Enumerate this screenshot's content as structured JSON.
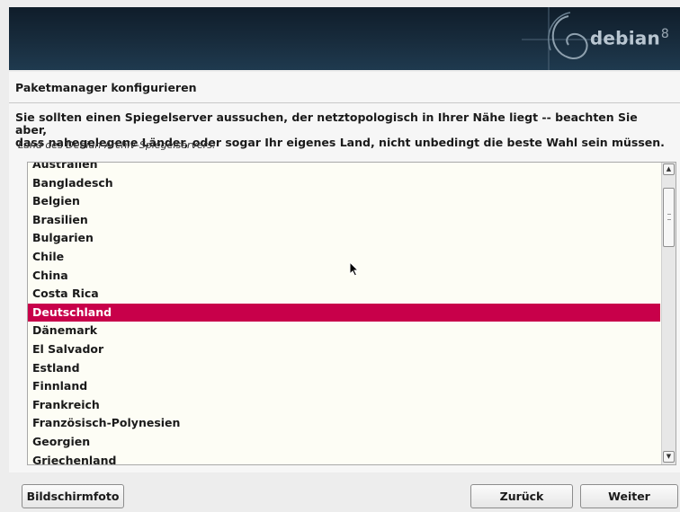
{
  "banner": {
    "brand": "debian",
    "version": "8"
  },
  "section": {
    "title": "Paketmanager konfigurieren"
  },
  "description": {
    "line1": "Sie sollten einen Spiegelserver aussuchen, der netztopologisch in Ihrer Nähe liegt -- beachten Sie aber,",
    "line2": "dass nahegelegene Länder, oder sogar Ihr eigenes Land, nicht unbedingt die beste Wahl sein müssen."
  },
  "field_label": "Land des Debian-Archiv-Spiegelservers:",
  "countries": [
    "Australien",
    "Bangladesch",
    "Belgien",
    "Brasilien",
    "Bulgarien",
    "Chile",
    "China",
    "Costa Rica",
    "Deutschland",
    "Dänemark",
    "El Salvador",
    "Estland",
    "Finnland",
    "Frankreich",
    "Französisch-Polynesien",
    "Georgien",
    "Griechenland"
  ],
  "selected_country": "Deutschland",
  "buttons": {
    "screenshot": "Bildschirmfoto",
    "back": "Zurück",
    "next": "Weiter"
  },
  "colors": {
    "selection": "#c8004a",
    "banner": "#182c3d"
  },
  "icons": {
    "scroll_up": "chevron-up-icon",
    "scroll_down": "chevron-down-icon",
    "cursor": "mouse-pointer-icon",
    "logo": "debian-swirl-icon"
  }
}
